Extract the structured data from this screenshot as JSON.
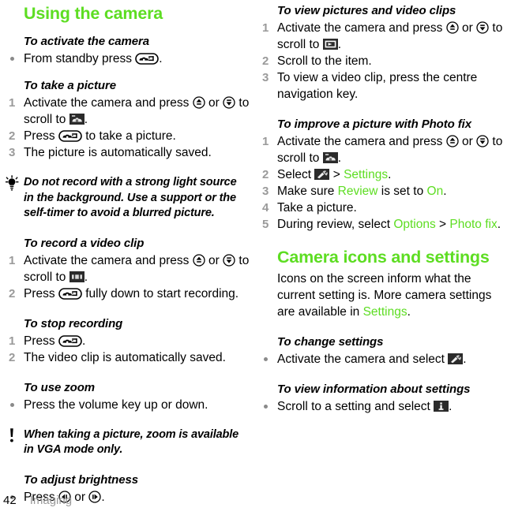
{
  "page": {
    "number": "42",
    "chapter": "Imaging",
    "accent_color": "#5ddd22",
    "num_color": "#9a9a9a"
  },
  "left": {
    "title": "Using the camera",
    "sections": [
      {
        "heading": "To activate the camera",
        "type": "bullet",
        "items": [
          {
            "pre": "From standby press ",
            "icon": "camera-button-icon",
            "post": "."
          }
        ]
      },
      {
        "heading": "To take a picture",
        "type": "numbered",
        "items": [
          {
            "pre": "Activate the camera and press ",
            "icon": "nav-up-icon",
            "mid": " or ",
            "icon2": "nav-down-icon",
            "post": " to scroll to ",
            "icon3": "camera-mode-icon",
            "tail": "."
          },
          {
            "pre": "Press ",
            "icon": "camera-button-icon",
            "post": " to take a picture."
          },
          {
            "pre": "The picture is automatically saved."
          }
        ]
      },
      {
        "note": {
          "icon": "tip-lightbulb-icon",
          "text": "Do not record with a strong light source in the background. Use a support or the self-timer to avoid a blurred picture."
        }
      },
      {
        "heading": "To record a video clip",
        "type": "numbered",
        "items": [
          {
            "pre": "Activate the camera and press ",
            "icon": "nav-up-icon",
            "mid": " or ",
            "icon2": "nav-down-icon",
            "post": " to scroll to ",
            "icon3": "video-mode-icon",
            "tail": "."
          },
          {
            "pre": "Press ",
            "icon": "camera-button-icon",
            "post": " fully down to start recording."
          }
        ]
      },
      {
        "heading": "To stop recording",
        "type": "numbered",
        "items": [
          {
            "pre": "Press ",
            "icon": "camera-button-icon",
            "post": "."
          },
          {
            "pre": "The video clip is automatically saved."
          }
        ]
      },
      {
        "heading": "To use zoom",
        "type": "bullet",
        "items": [
          {
            "pre": "Press the volume key up or down."
          }
        ]
      },
      {
        "note": {
          "icon": "warning-exclamation-icon",
          "text": "When taking a picture, zoom is available in VGA mode only."
        }
      },
      {
        "heading": "To adjust brightness",
        "type": "bullet",
        "items": [
          {
            "pre": "Press ",
            "icon": "nav-left-icon",
            "mid": " or ",
            "icon2": "nav-right-icon",
            "post": "."
          }
        ]
      }
    ]
  },
  "right": {
    "sections": [
      {
        "heading": "To view pictures and video clips",
        "type": "numbered",
        "items": [
          {
            "pre": "Activate the camera and press ",
            "icon": "nav-up-icon",
            "mid": " or ",
            "icon2": "nav-down-icon",
            "post": " to scroll to ",
            "icon3": "gallery-mode-icon",
            "tail": "."
          },
          {
            "pre": "Scroll to the item."
          },
          {
            "pre": "To view a video clip, press the centre navigation key."
          }
        ]
      },
      {
        "heading": "To improve a picture with Photo fix",
        "type": "numbered",
        "items": [
          {
            "pre": "Activate the camera and press ",
            "icon": "nav-up-icon",
            "mid": " or ",
            "icon2": "nav-down-icon",
            "post": " to scroll to ",
            "icon3": "photofix-mode-icon",
            "tail": "."
          },
          {
            "pre": "Select ",
            "icon": "settings-wrench-icon",
            "post": " > ",
            "green": "Settings",
            "tail": "."
          },
          {
            "pre": "Make sure ",
            "green": "Review",
            "post": " is set to ",
            "green2": "On",
            "tail": "."
          },
          {
            "pre": "Take a picture."
          },
          {
            "pre": "During review, select ",
            "green": "Options",
            "post": " > ",
            "green2": "Photo fix",
            "tail": "."
          }
        ]
      }
    ],
    "title2": "Camera icons and settings",
    "intro": {
      "pre": "Icons on the screen inform what the current setting is. More camera settings are available in ",
      "green": "Settings",
      "post": "."
    },
    "sections2": [
      {
        "heading": "To change settings",
        "type": "bullet",
        "items": [
          {
            "pre": "Activate the camera and select ",
            "icon": "settings-wrench-icon",
            "post": "."
          }
        ]
      },
      {
        "heading": "To view information about settings",
        "type": "bullet",
        "items": [
          {
            "pre": "Scroll to a setting and select ",
            "icon": "info-icon",
            "post": "."
          }
        ]
      }
    ]
  }
}
